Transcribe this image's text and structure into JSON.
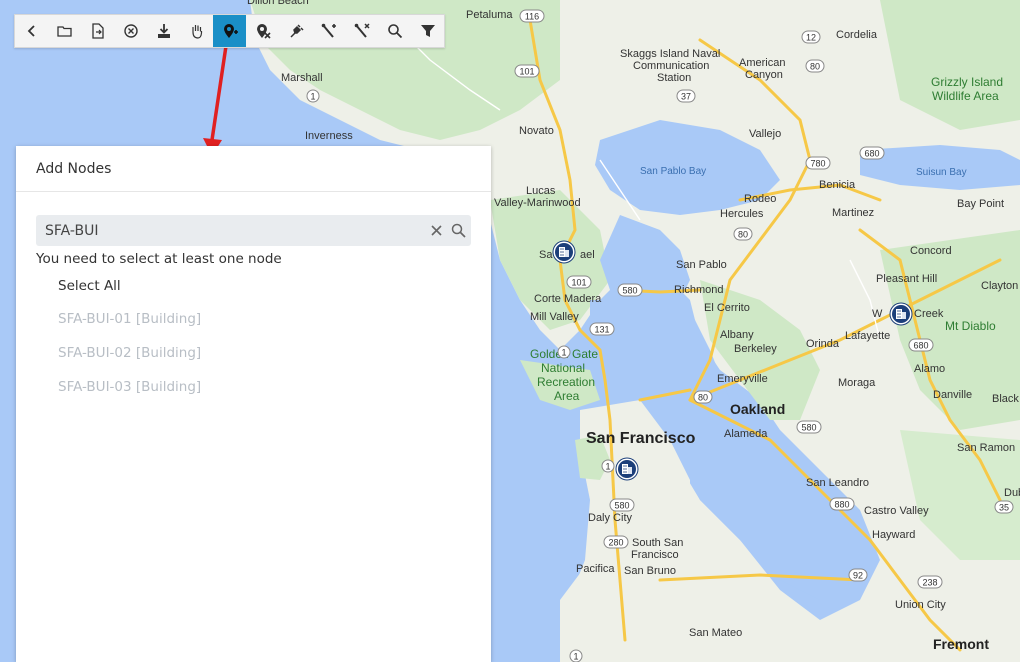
{
  "toolbar": {
    "buttons": [
      {
        "name": "back-icon",
        "active": false
      },
      {
        "name": "open-folder-icon",
        "active": false
      },
      {
        "name": "export-file-icon",
        "active": false
      },
      {
        "name": "close-circle-icon",
        "active": false
      },
      {
        "name": "download-icon",
        "active": false
      },
      {
        "name": "hand-pan-icon",
        "active": false
      },
      {
        "name": "add-node-icon",
        "active": true
      },
      {
        "name": "remove-node-icon",
        "active": false
      },
      {
        "name": "plug-icon",
        "active": false
      },
      {
        "name": "add-link-icon",
        "active": false
      },
      {
        "name": "remove-link-icon",
        "active": false
      },
      {
        "name": "search-icon",
        "active": false
      },
      {
        "name": "filter-icon",
        "active": false
      }
    ],
    "active_color": "#1a8fc7"
  },
  "panel": {
    "title": "Add Nodes",
    "search_value": "SFA-BUI",
    "validation_message": "You need to select at least one node",
    "select_all_label": "Select All",
    "items": [
      "SFA-BUI-01 [Building]",
      "SFA-BUI-02 [Building]",
      "SFA-BUI-03 [Building]"
    ]
  },
  "map": {
    "places": [
      {
        "text": "Petaluma"
      },
      {
        "text": "Skaggs Island Naval"
      },
      {
        "text": "Communication"
      },
      {
        "text": "Station"
      },
      {
        "text": "American"
      },
      {
        "text": "Canyon"
      },
      {
        "text": "Cordelia"
      },
      {
        "text": "Grizzly Island"
      },
      {
        "text": "Wildlife Area"
      },
      {
        "text": "Marshall"
      },
      {
        "text": "Inverness"
      },
      {
        "text": "Novato"
      },
      {
        "text": "Vallejo"
      },
      {
        "text": "San Pablo Bay"
      },
      {
        "text": "Benicia"
      },
      {
        "text": "Suisun Bay"
      },
      {
        "text": "Lucas"
      },
      {
        "text": "Valley-Marinwood"
      },
      {
        "text": "Rodeo"
      },
      {
        "text": "Hercules"
      },
      {
        "text": "Martinez"
      },
      {
        "text": "Bay Point"
      },
      {
        "text": "Sa"
      },
      {
        "text": "ael"
      },
      {
        "text": "San Pablo"
      },
      {
        "text": "Concord"
      },
      {
        "text": "Corte Madera"
      },
      {
        "text": "Richmond"
      },
      {
        "text": "El Cerrito"
      },
      {
        "text": "Pleasant Hill"
      },
      {
        "text": "Clayton"
      },
      {
        "text": "Mill Valley"
      },
      {
        "text": "W"
      },
      {
        "text": "Creek"
      },
      {
        "text": "Mt Diablo"
      },
      {
        "text": "Albany"
      },
      {
        "text": "Lafayette"
      },
      {
        "text": "Golden Gate"
      },
      {
        "text": "National"
      },
      {
        "text": "Recreation"
      },
      {
        "text": "Area"
      },
      {
        "text": "Berkeley"
      },
      {
        "text": "Orinda"
      },
      {
        "text": "Alamo"
      },
      {
        "text": "Emeryville"
      },
      {
        "text": "Moraga"
      },
      {
        "text": "Oakland"
      },
      {
        "text": "Danville"
      },
      {
        "text": "Black"
      },
      {
        "text": "San Francisco"
      },
      {
        "text": "Alameda"
      },
      {
        "text": "San Ramon"
      },
      {
        "text": "San Leandro"
      },
      {
        "text": "Dub"
      },
      {
        "text": "Daly City"
      },
      {
        "text": "Castro Valley"
      },
      {
        "text": "South San"
      },
      {
        "text": "Francisco"
      },
      {
        "text": "Hayward"
      },
      {
        "text": "Pacifica"
      },
      {
        "text": "San Bruno"
      },
      {
        "text": "Union City"
      },
      {
        "text": "San Mateo"
      },
      {
        "text": "Fremont"
      },
      {
        "text": "Dillon Beach"
      }
    ],
    "shields": [
      "116",
      "101",
      "37",
      "12",
      "80",
      "1",
      "780",
      "680",
      "80",
      "580",
      "101",
      "131",
      "1",
      "80",
      "580",
      "680",
      "880",
      "238",
      "92",
      "580",
      "1",
      "280",
      "35",
      "1"
    ],
    "building_markers": 3
  }
}
